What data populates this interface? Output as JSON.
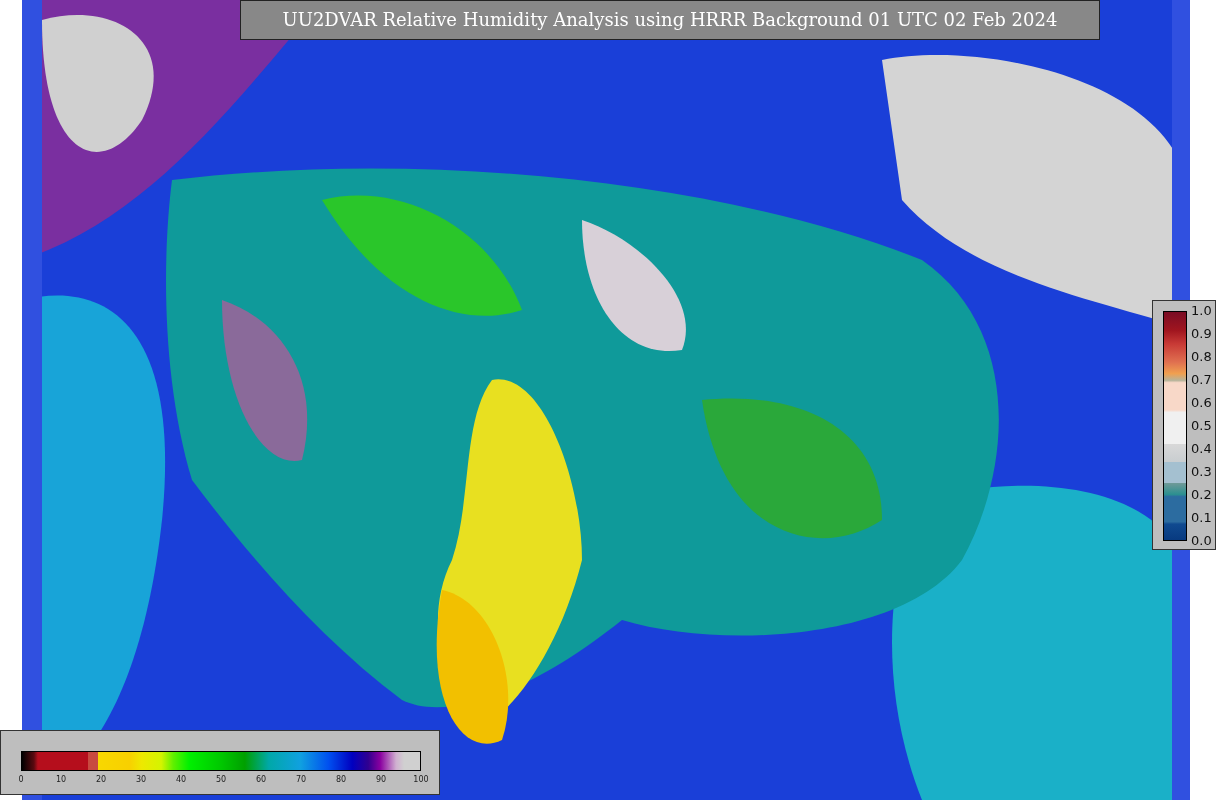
{
  "title": "UU2DVAR Relative Humidity Analysis using HRRR Background 01 UTC 02 Feb 2024",
  "humidity_colorbar": {
    "ticks": [
      "0",
      "10",
      "20",
      "30",
      "40",
      "50",
      "60",
      "70",
      "80",
      "90",
      "100"
    ]
  },
  "ratio_colorbar": {
    "ticks": [
      "1.0",
      "0.9",
      "0.8",
      "0.7",
      "0.6",
      "0.5",
      "0.4",
      "0.3",
      "0.2",
      "0.1",
      "0.0"
    ]
  }
}
